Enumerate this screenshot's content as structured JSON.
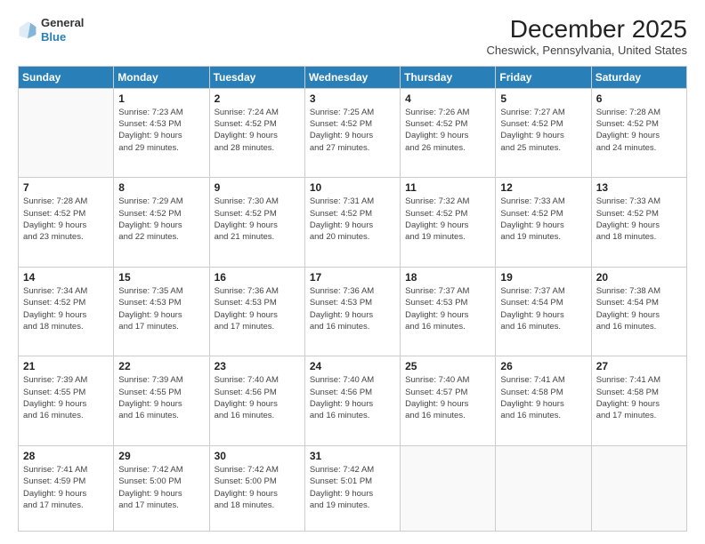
{
  "header": {
    "logo": {
      "line1": "General",
      "line2": "Blue"
    },
    "title": "December 2025",
    "location": "Cheswick, Pennsylvania, United States"
  },
  "calendar": {
    "days": [
      "Sunday",
      "Monday",
      "Tuesday",
      "Wednesday",
      "Thursday",
      "Friday",
      "Saturday"
    ],
    "weeks": [
      [
        {
          "day": "",
          "info": ""
        },
        {
          "day": "1",
          "info": "Sunrise: 7:23 AM\nSunset: 4:53 PM\nDaylight: 9 hours\nand 29 minutes."
        },
        {
          "day": "2",
          "info": "Sunrise: 7:24 AM\nSunset: 4:52 PM\nDaylight: 9 hours\nand 28 minutes."
        },
        {
          "day": "3",
          "info": "Sunrise: 7:25 AM\nSunset: 4:52 PM\nDaylight: 9 hours\nand 27 minutes."
        },
        {
          "day": "4",
          "info": "Sunrise: 7:26 AM\nSunset: 4:52 PM\nDaylight: 9 hours\nand 26 minutes."
        },
        {
          "day": "5",
          "info": "Sunrise: 7:27 AM\nSunset: 4:52 PM\nDaylight: 9 hours\nand 25 minutes."
        },
        {
          "day": "6",
          "info": "Sunrise: 7:28 AM\nSunset: 4:52 PM\nDaylight: 9 hours\nand 24 minutes."
        }
      ],
      [
        {
          "day": "7",
          "info": "Sunrise: 7:28 AM\nSunset: 4:52 PM\nDaylight: 9 hours\nand 23 minutes."
        },
        {
          "day": "8",
          "info": "Sunrise: 7:29 AM\nSunset: 4:52 PM\nDaylight: 9 hours\nand 22 minutes."
        },
        {
          "day": "9",
          "info": "Sunrise: 7:30 AM\nSunset: 4:52 PM\nDaylight: 9 hours\nand 21 minutes."
        },
        {
          "day": "10",
          "info": "Sunrise: 7:31 AM\nSunset: 4:52 PM\nDaylight: 9 hours\nand 20 minutes."
        },
        {
          "day": "11",
          "info": "Sunrise: 7:32 AM\nSunset: 4:52 PM\nDaylight: 9 hours\nand 19 minutes."
        },
        {
          "day": "12",
          "info": "Sunrise: 7:33 AM\nSunset: 4:52 PM\nDaylight: 9 hours\nand 19 minutes."
        },
        {
          "day": "13",
          "info": "Sunrise: 7:33 AM\nSunset: 4:52 PM\nDaylight: 9 hours\nand 18 minutes."
        }
      ],
      [
        {
          "day": "14",
          "info": "Sunrise: 7:34 AM\nSunset: 4:52 PM\nDaylight: 9 hours\nand 18 minutes."
        },
        {
          "day": "15",
          "info": "Sunrise: 7:35 AM\nSunset: 4:53 PM\nDaylight: 9 hours\nand 17 minutes."
        },
        {
          "day": "16",
          "info": "Sunrise: 7:36 AM\nSunset: 4:53 PM\nDaylight: 9 hours\nand 17 minutes."
        },
        {
          "day": "17",
          "info": "Sunrise: 7:36 AM\nSunset: 4:53 PM\nDaylight: 9 hours\nand 16 minutes."
        },
        {
          "day": "18",
          "info": "Sunrise: 7:37 AM\nSunset: 4:53 PM\nDaylight: 9 hours\nand 16 minutes."
        },
        {
          "day": "19",
          "info": "Sunrise: 7:37 AM\nSunset: 4:54 PM\nDaylight: 9 hours\nand 16 minutes."
        },
        {
          "day": "20",
          "info": "Sunrise: 7:38 AM\nSunset: 4:54 PM\nDaylight: 9 hours\nand 16 minutes."
        }
      ],
      [
        {
          "day": "21",
          "info": "Sunrise: 7:39 AM\nSunset: 4:55 PM\nDaylight: 9 hours\nand 16 minutes."
        },
        {
          "day": "22",
          "info": "Sunrise: 7:39 AM\nSunset: 4:55 PM\nDaylight: 9 hours\nand 16 minutes."
        },
        {
          "day": "23",
          "info": "Sunrise: 7:40 AM\nSunset: 4:56 PM\nDaylight: 9 hours\nand 16 minutes."
        },
        {
          "day": "24",
          "info": "Sunrise: 7:40 AM\nSunset: 4:56 PM\nDaylight: 9 hours\nand 16 minutes."
        },
        {
          "day": "25",
          "info": "Sunrise: 7:40 AM\nSunset: 4:57 PM\nDaylight: 9 hours\nand 16 minutes."
        },
        {
          "day": "26",
          "info": "Sunrise: 7:41 AM\nSunset: 4:58 PM\nDaylight: 9 hours\nand 16 minutes."
        },
        {
          "day": "27",
          "info": "Sunrise: 7:41 AM\nSunset: 4:58 PM\nDaylight: 9 hours\nand 17 minutes."
        }
      ],
      [
        {
          "day": "28",
          "info": "Sunrise: 7:41 AM\nSunset: 4:59 PM\nDaylight: 9 hours\nand 17 minutes."
        },
        {
          "day": "29",
          "info": "Sunrise: 7:42 AM\nSunset: 5:00 PM\nDaylight: 9 hours\nand 17 minutes."
        },
        {
          "day": "30",
          "info": "Sunrise: 7:42 AM\nSunset: 5:00 PM\nDaylight: 9 hours\nand 18 minutes."
        },
        {
          "day": "31",
          "info": "Sunrise: 7:42 AM\nSunset: 5:01 PM\nDaylight: 9 hours\nand 19 minutes."
        },
        {
          "day": "",
          "info": ""
        },
        {
          "day": "",
          "info": ""
        },
        {
          "day": "",
          "info": ""
        }
      ]
    ]
  }
}
